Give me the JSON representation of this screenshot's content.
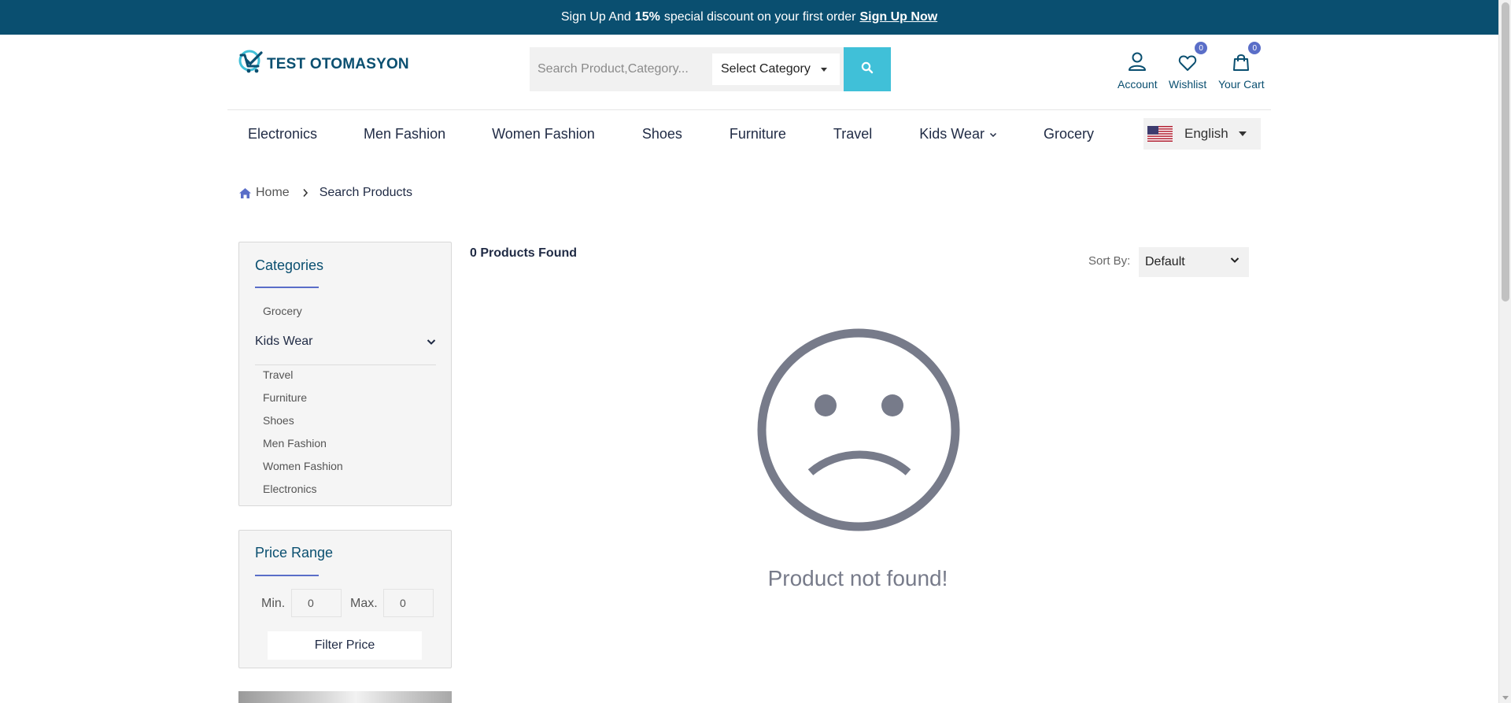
{
  "promo": {
    "text_before": "Sign Up And",
    "discount": "15%",
    "text_after": "special discount on your first order",
    "link": "Sign Up Now"
  },
  "logo": {
    "text": "TEST OTOMASYON"
  },
  "search": {
    "placeholder": "Search Product,Category...",
    "category_label": "Select Category"
  },
  "header": {
    "account_label": "Account",
    "wishlist_label": "Wishlist",
    "wishlist_count": "0",
    "cart_label": "Your Cart",
    "cart_count": "0"
  },
  "nav": {
    "items": [
      "Electronics",
      "Men Fashion",
      "Women Fashion",
      "Shoes",
      "Furniture",
      "Travel",
      "Kids Wear",
      "Grocery"
    ]
  },
  "language": {
    "label": "English"
  },
  "breadcrumb": {
    "home": "Home",
    "current": "Search Products"
  },
  "sidebar": {
    "categories_title": "Categories",
    "top_category": "Grocery",
    "expanded_category": "Kids Wear",
    "sub_categories": [
      "Travel",
      "Furniture",
      "Shoes",
      "Men Fashion",
      "Women Fashion",
      "Electronics"
    ],
    "price_title": "Price Range",
    "min_label": "Min.",
    "min_value": "0",
    "max_label": "Max.",
    "max_value": "0",
    "filter_button": "Filter Price"
  },
  "results": {
    "count": "0",
    "count_label": "Products Found",
    "sort_label": "Sort By:",
    "sort_value": "Default",
    "empty_message": "Product not found!"
  },
  "colors": {
    "topbar": "#0a4f70",
    "accent": "#40c0d8",
    "badge": "#5a6ec8",
    "sad_face": "#777b8a"
  }
}
